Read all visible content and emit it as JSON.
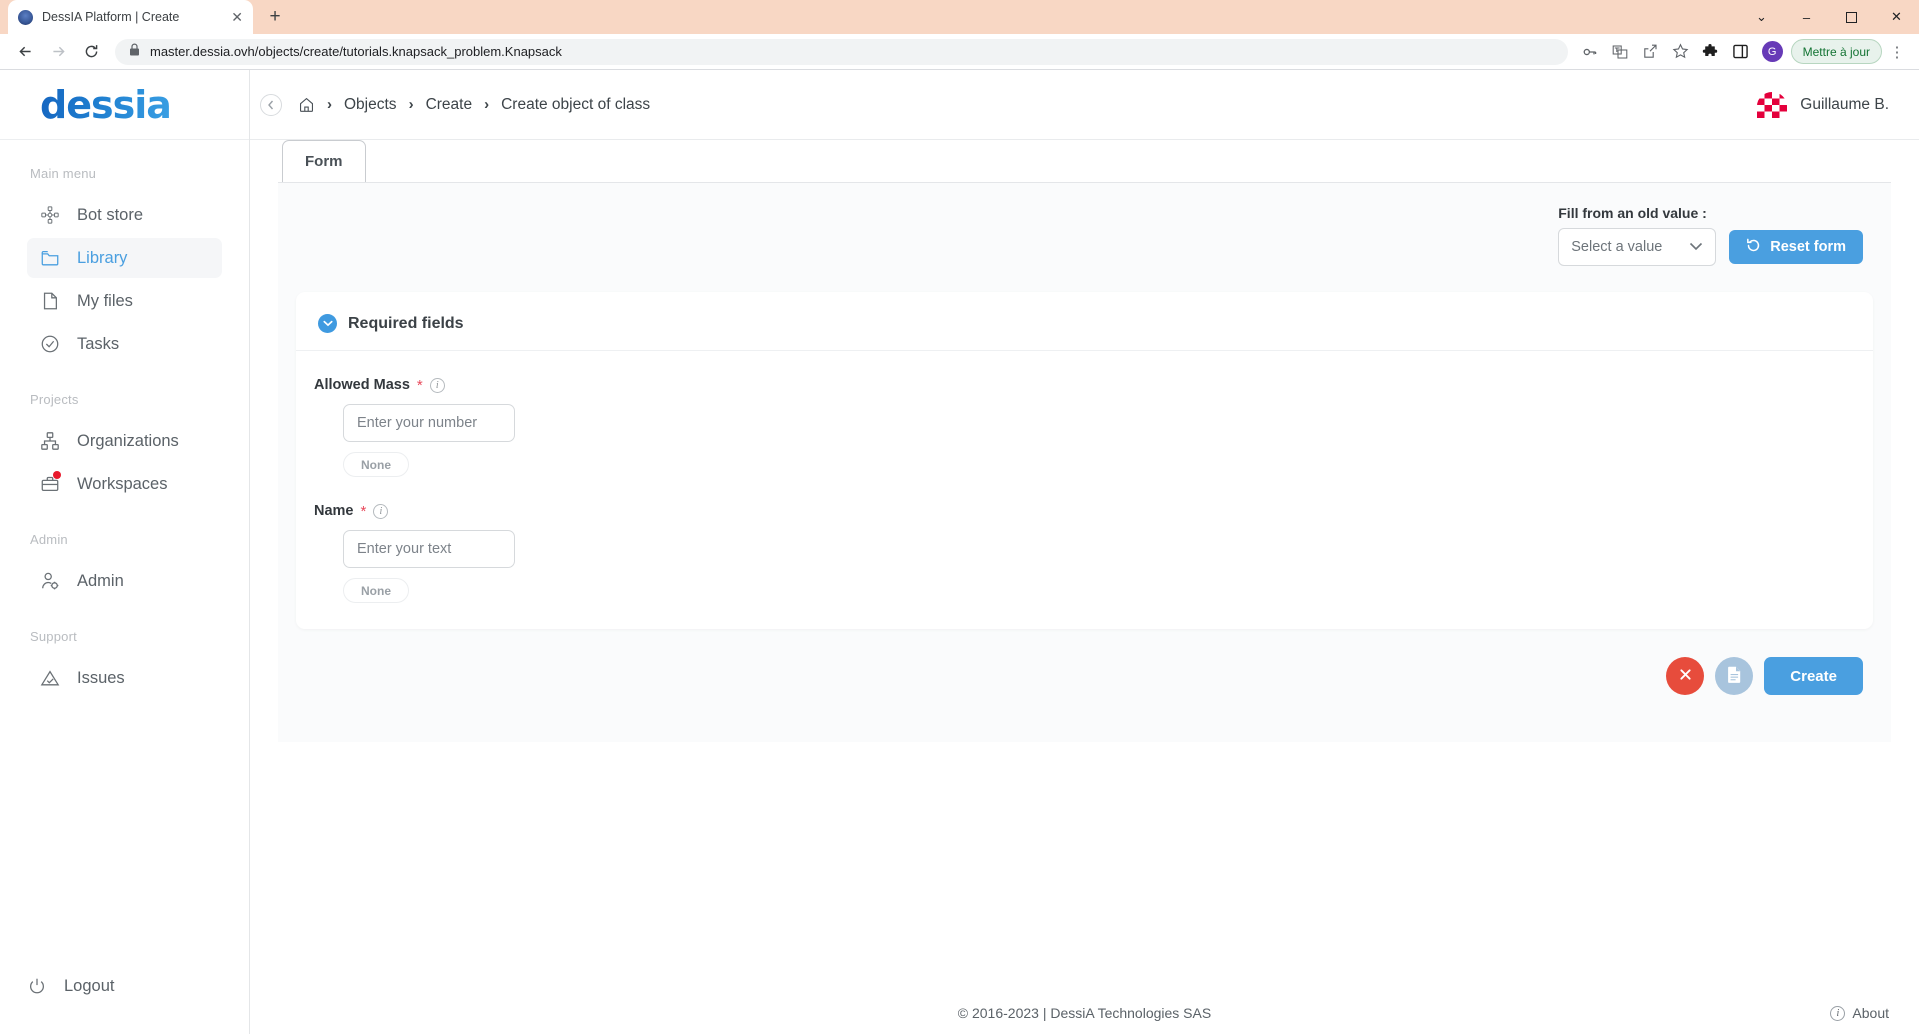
{
  "browser": {
    "tab": {
      "title": "DessIA Platform | Create",
      "favicon": "globe-icon",
      "close": "✕"
    },
    "new_tab": "+",
    "window_controls": {
      "minimize_group": "⌄",
      "minimize": "–",
      "maximize": "❐",
      "close": "✕"
    },
    "nav": {
      "back": "←",
      "forward": "→",
      "reload": "↻"
    },
    "omnibox": {
      "lock": "lock-icon",
      "url": "master.dessia.ovh/objects/create/tutorials.knapsack_problem.Knapsack"
    },
    "toolbar_icons": [
      "password-key-icon",
      "translate-icon",
      "share-icon",
      "bookmark-star-icon",
      "extensions-puzzle-icon",
      "sidepanel-icon"
    ],
    "profile_initial": "G",
    "update_button": "Mettre à jour",
    "menu_kebab": "⋮"
  },
  "sidebar": {
    "logo": "dessia",
    "sections": [
      {
        "label": "Main menu",
        "items": [
          {
            "label": "Bot store",
            "icon": "bot-network-icon",
            "active": false
          },
          {
            "label": "Library",
            "icon": "folder-icon",
            "active": true
          },
          {
            "label": "My files",
            "icon": "file-icon",
            "active": false
          },
          {
            "label": "Tasks",
            "icon": "check-circle-icon",
            "active": false
          }
        ]
      },
      {
        "label": "Projects",
        "items": [
          {
            "label": "Organizations",
            "icon": "org-chart-icon",
            "active": false
          },
          {
            "label": "Workspaces",
            "icon": "briefcase-icon",
            "active": false,
            "badge": true
          }
        ]
      },
      {
        "label": "Admin",
        "items": [
          {
            "label": "Admin",
            "icon": "user-gear-icon",
            "active": false
          }
        ]
      },
      {
        "label": "Support",
        "items": [
          {
            "label": "Issues",
            "icon": "warning-triangle-icon",
            "active": false
          }
        ]
      }
    ],
    "logout": {
      "label": "Logout",
      "icon": "power-icon"
    }
  },
  "topbar": {
    "collapse_icon": "chevron-left-icon",
    "breadcrumb": {
      "home_icon": "home-icon",
      "separator": "›",
      "items": [
        "Objects",
        "Create",
        "Create object of class"
      ]
    },
    "user": {
      "name": "Guillaume B.",
      "avatar": "checkered-dome-avatar",
      "avatar_color": "#e4003c"
    }
  },
  "content": {
    "tab": {
      "label": "Form"
    },
    "fill_from_old": {
      "label": "Fill from an old value :",
      "select_placeholder": "Select a value",
      "chevron": "chevron-down-icon",
      "reset_button": {
        "label": "Reset form",
        "icon": "reset-arrow-icon"
      }
    },
    "card": {
      "title": "Required fields",
      "toggle_icon": "chevron-down-circle-icon",
      "fields": [
        {
          "label": "Allowed Mass",
          "required_marker": "*",
          "info_icon": "info-icon",
          "input_placeholder": "Enter your number",
          "input_value": "",
          "chip": "None"
        },
        {
          "label": "Name",
          "required_marker": "*",
          "info_icon": "info-icon",
          "input_placeholder": "Enter your text",
          "input_value": "",
          "chip": "None"
        }
      ]
    },
    "actions": {
      "cancel": {
        "icon": "close-x-icon",
        "color": "#e74c3c"
      },
      "draft": {
        "icon": "document-icon",
        "color": "#a8c4dd"
      },
      "create": {
        "label": "Create",
        "color": "#4a9fe0"
      }
    }
  },
  "footer": {
    "copyright": "© 2016-2023 | DessiA Technologies SAS",
    "about": {
      "label": "About",
      "icon": "info-icon"
    }
  },
  "colors": {
    "accent_blue": "#4a9fe0",
    "brand_blue": "#1976d2",
    "danger_red": "#e74c3c",
    "required_star": "#e8495b",
    "badge_red": "#e8192c",
    "tabstrip": "#f8d7c4"
  }
}
